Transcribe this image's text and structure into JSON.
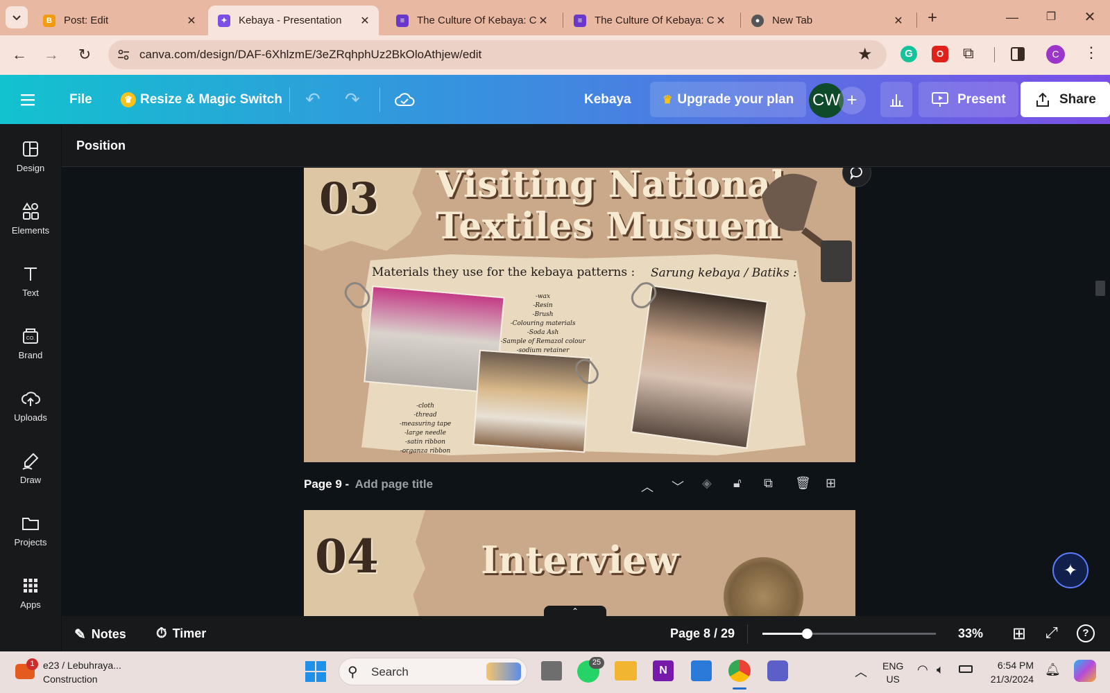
{
  "browser": {
    "tabs": [
      {
        "title": "Post: Edit",
        "favicon": "blogger",
        "color": "#f39c12",
        "active": false
      },
      {
        "title": "Kebaya - Presentation",
        "favicon": "canva",
        "color": "#7b4fe6",
        "active": true
      },
      {
        "title": "The Culture Of Kebaya: C",
        "favicon": "doc",
        "color": "#6a38c9",
        "active": false
      },
      {
        "title": "The Culture Of Kebaya: C",
        "favicon": "doc",
        "color": "#6a38c9",
        "active": false
      },
      {
        "title": "New Tab",
        "favicon": "chrome",
        "color": "#555555",
        "active": false
      }
    ],
    "url": "canva.com/design/DAF-6XhlzmE/3eZRqhphUz2BkOloAthjew/edit",
    "profile_initial": "C"
  },
  "header": {
    "menu_icon": "hamburger-icon",
    "file_label": "File",
    "resize_label": "Resize & Magic Switch",
    "design_title": "Kebaya",
    "upgrade_label": "Upgrade your plan",
    "avatar_initials": "CW",
    "present_label": "Present",
    "share_label": "Share"
  },
  "rail": [
    {
      "label": "Design",
      "icon": "layout-icon"
    },
    {
      "label": "Elements",
      "icon": "shapes-icon"
    },
    {
      "label": "Text",
      "icon": "text-icon"
    },
    {
      "label": "Brand",
      "icon": "brand-icon"
    },
    {
      "label": "Uploads",
      "icon": "cloud-upload-icon"
    },
    {
      "label": "Draw",
      "icon": "pen-icon"
    },
    {
      "label": "Projects",
      "icon": "folder-icon"
    },
    {
      "label": "Apps",
      "icon": "grid-icon"
    }
  ],
  "position_label": "Position",
  "slide8": {
    "number": "03",
    "title_line1": "Visiting National",
    "title_line2": "Textiles Musuem",
    "materials_heading": "Materials they use for the kebaya patterns :",
    "sarung_heading": "Sarung kebaya / Batiks :",
    "materials_list": [
      "-wax",
      "-Resin",
      "-Brush",
      "-Colouring materials",
      "-Soda Ash",
      "-Sample of Remazol colour",
      "-sodium retainer"
    ],
    "sewing_list": [
      "-cloth",
      "-thread",
      "-measuring tape",
      "-large needle",
      "-satin ribbon",
      "-organza ribbon"
    ]
  },
  "page9": {
    "label": "Page 9 -",
    "title_placeholder": "Add page title",
    "number": "04",
    "title": "Interview"
  },
  "bottom": {
    "notes_label": "Notes",
    "timer_label": "Timer",
    "page_indicator": "Page 8 / 29",
    "zoom_level": 0.33,
    "zoom_text": "33%"
  },
  "taskbar": {
    "weather_title": "e23 / Lebuhraya...",
    "weather_sub": "Construction",
    "weather_badge": "1",
    "search_placeholder": "Search",
    "whatsapp_badge": "25",
    "lang_line1": "ENG",
    "lang_line2": "US",
    "time": "6:54 PM",
    "date": "21/3/2024"
  }
}
